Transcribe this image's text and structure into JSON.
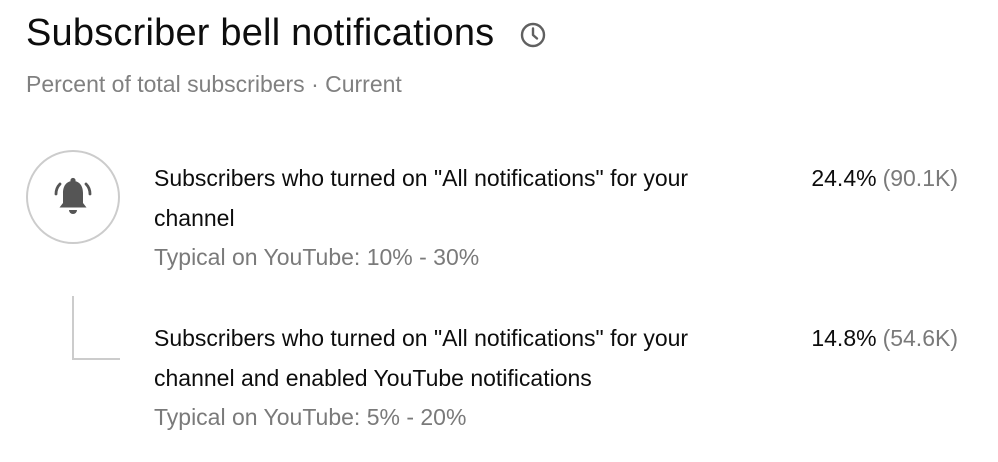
{
  "header": {
    "title": "Subscriber bell notifications",
    "subtitle": "Percent of total subscribers · Current"
  },
  "icons": {
    "clock": "clock-icon",
    "bell": "bell-ringing-icon"
  },
  "colors": {
    "text_primary": "#0d0d0d",
    "text_secondary": "#7a7a7a",
    "outline": "#cccccc",
    "icon_fill": "#555555"
  },
  "rows": [
    {
      "description": "Subscribers who turned on \"All notifications\" for your channel",
      "typical": "Typical on YouTube: 10% - 30%",
      "percent": "24.4%",
      "count": "(90.1K)"
    },
    {
      "description": "Subscribers who turned on \"All notifications\" for your channel and enabled YouTube notifications",
      "typical": "Typical on YouTube: 5% - 20%",
      "percent": "14.8%",
      "count": "(54.6K)"
    }
  ]
}
